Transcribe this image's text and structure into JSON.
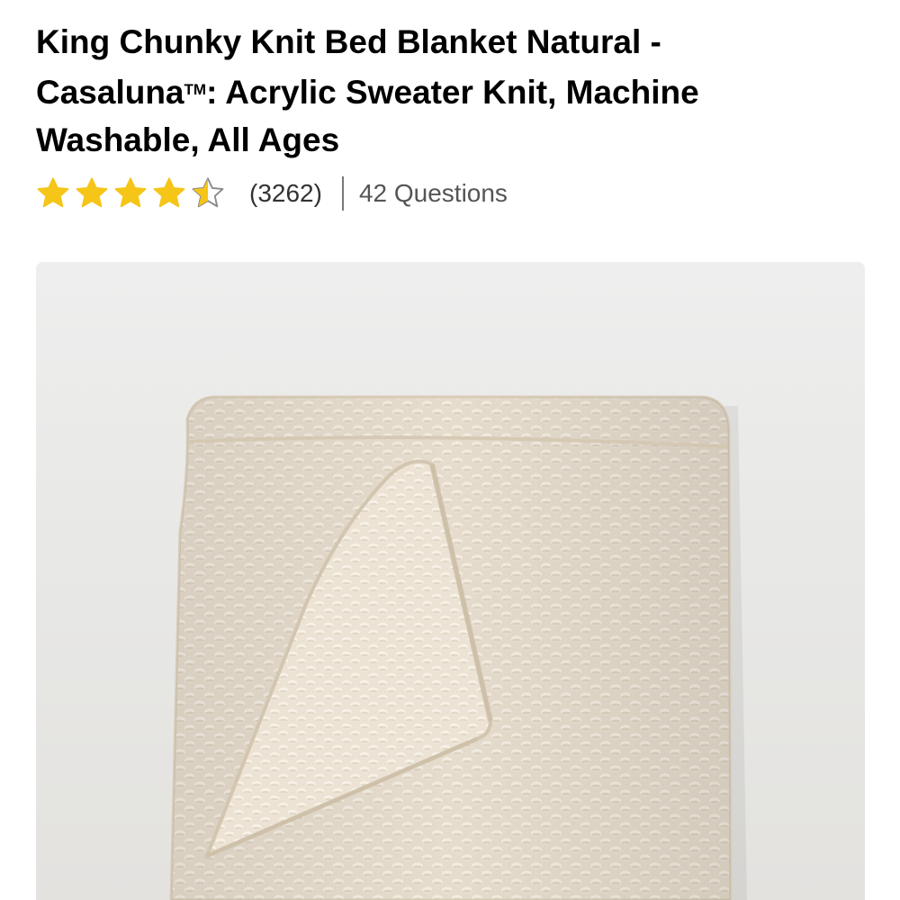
{
  "product": {
    "title_part1": "King Chunky Knit Bed Blanket Natural - Casaluna",
    "trademark": "TM",
    "title_part2": ": Acrylic Sweater Knit, Machine Washable, All Ages",
    "rating_value": 4.5,
    "rating_max": 5,
    "rating_count": "(3262)",
    "questions": "42 Questions",
    "image_name": "chunky-knit-blanket-photo"
  },
  "colors": {
    "star_fill": "#F5C518",
    "star_empty_stroke": "#8A8A8A",
    "text_primary": "#000000",
    "text_secondary": "#555555",
    "image_background": "#EAEAEA",
    "blanket": "#E7DED0"
  }
}
